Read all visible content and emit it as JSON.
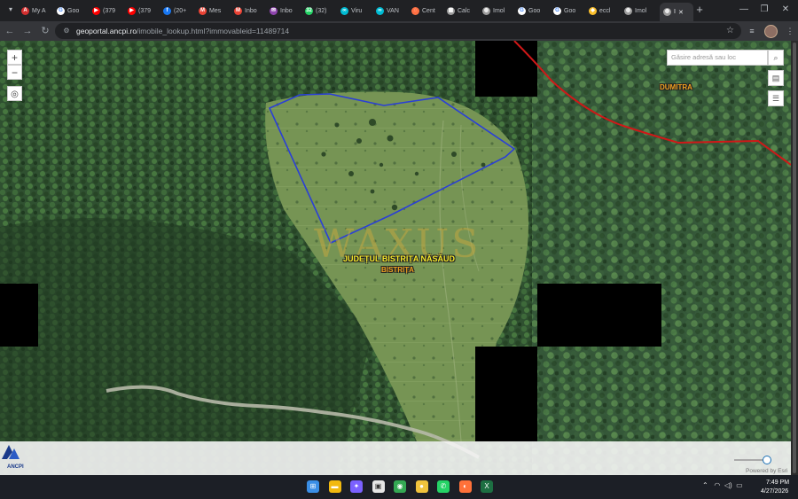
{
  "browser": {
    "tabs": [
      {
        "label": "My A",
        "icon": "adobe-icon",
        "color": "#d32f2f",
        "glyph": "A"
      },
      {
        "label": "Goo",
        "icon": "google-icon",
        "color": "#ffffff",
        "glyph": "G"
      },
      {
        "label": "(379",
        "icon": "youtube-icon",
        "color": "#ff0000",
        "glyph": "▶"
      },
      {
        "label": "(379",
        "icon": "youtube-icon",
        "color": "#ff0000",
        "glyph": "▶"
      },
      {
        "label": "(20+",
        "icon": "facebook-icon",
        "color": "#1877f2",
        "glyph": "f"
      },
      {
        "label": "Mes",
        "icon": "gmail-icon",
        "color": "#ea4335",
        "glyph": "M"
      },
      {
        "label": "Inbo",
        "icon": "gmail-icon",
        "color": "#ea4335",
        "glyph": "M"
      },
      {
        "label": "Inbo",
        "icon": "mail-icon",
        "color": "#8e44ad",
        "glyph": "✉"
      },
      {
        "label": "(32)",
        "icon": "whatsapp-icon",
        "color": "#25d366",
        "glyph": "32"
      },
      {
        "label": "Viru",
        "icon": "vpn-icon",
        "color": "#00bcd4",
        "glyph": "∞"
      },
      {
        "label": "VAN",
        "icon": "vpn-icon",
        "color": "#00bcd4",
        "glyph": "∞"
      },
      {
        "label": "Cent",
        "icon": "circle-icon",
        "color": "#ff7043",
        "glyph": "◌"
      },
      {
        "label": "Calc",
        "icon": "calculator-icon",
        "color": "#9e9e9e",
        "glyph": "▦"
      },
      {
        "label": "Imol",
        "icon": "globe-icon",
        "color": "#9e9e9e",
        "glyph": "◍"
      },
      {
        "label": "Goo",
        "icon": "google-icon",
        "color": "#ffffff",
        "glyph": "G"
      },
      {
        "label": "Goo",
        "icon": "google-icon",
        "color": "#ffffff",
        "glyph": "G"
      },
      {
        "label": "eccl",
        "icon": "shield-icon",
        "color": "#fbc02d",
        "glyph": "◆"
      },
      {
        "label": "Imol",
        "icon": "globe-icon",
        "color": "#9e9e9e",
        "glyph": "◍"
      }
    ],
    "active_tab": {
      "label": "I",
      "icon": "globe-icon"
    },
    "url_host": "geoportal.ancpi.ro",
    "url_path": "/imobile_lookup.html?immovableid=11489714"
  },
  "map": {
    "search_placeholder": "Găsire adresă sau loc",
    "labels": {
      "county": "JUDEȚUL BISTRIȚA NĂSĂUD",
      "locality_main": "BISTRIȚA",
      "locality_ne": "DUMITRA"
    },
    "watermark": "WAXUS",
    "logo_text": "ANCPI",
    "attribution": "Powered by Esri",
    "zoom_level_fraction": 0.85,
    "parcel_color": "#2a3fd6",
    "boundary_color": "#d01818"
  },
  "taskbar": {
    "apps": [
      {
        "icon": "windows-start-icon",
        "color": "#3a8ee6",
        "glyph": "⊞"
      },
      {
        "icon": "file-explorer-icon",
        "color": "#f2b90f",
        "glyph": "▬"
      },
      {
        "icon": "copilot-icon",
        "color": "#7b61ff",
        "glyph": "✦"
      },
      {
        "icon": "store-icon",
        "color": "#e6e6e6",
        "glyph": "▣"
      },
      {
        "icon": "chrome-icon",
        "color": "#34a853",
        "glyph": "◉"
      },
      {
        "icon": "chat-icon",
        "color": "#f0c33c",
        "glyph": "●"
      },
      {
        "icon": "whatsapp-icon",
        "color": "#25d366",
        "glyph": "✆"
      },
      {
        "icon": "firefox-icon",
        "color": "#ff7139",
        "glyph": "◐"
      },
      {
        "icon": "excel-icon",
        "color": "#1d6f42",
        "glyph": "X"
      }
    ],
    "time": "7:49 PM",
    "date": "4/27/2026"
  }
}
